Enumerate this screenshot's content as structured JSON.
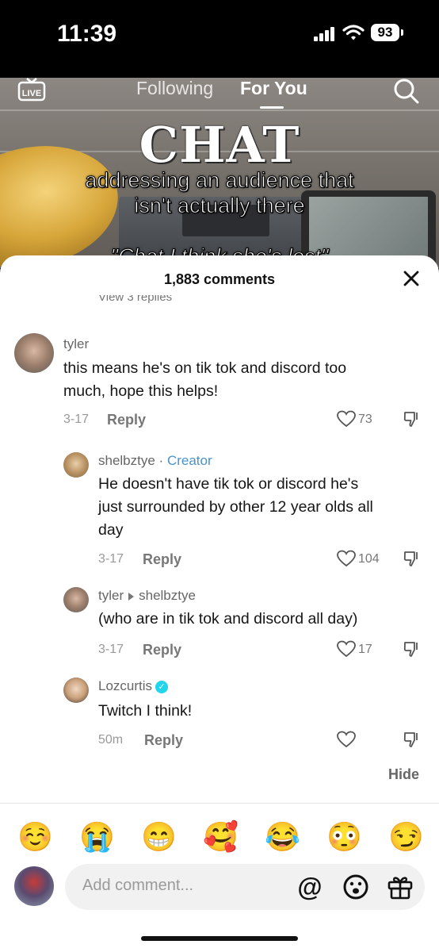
{
  "status_bar": {
    "time": "11:39",
    "battery": "93"
  },
  "video": {
    "tabs": {
      "following": "Following",
      "for_you": "For You"
    },
    "title": "CHAT",
    "caption_line1": "addressing an audience that",
    "caption_line2": "isn't actually there",
    "caption_line3": "\"Chat I think she's lost\""
  },
  "comments_panel": {
    "count_label": "1,883 comments",
    "view_replies": "View 3 replies",
    "comments": [
      {
        "username": "tyler",
        "text_line1": "this means he's on tik tok and discord too",
        "text_line2": "much, hope this helps!",
        "date": "3-17",
        "reply": "Reply",
        "likes": "73"
      },
      {
        "username": "shelbztye",
        "creator_label": "Creator",
        "text_line1": "He doesn't have tik tok or discord he's",
        "text_line2": "just surrounded by other 12 year olds all",
        "text_line3": "day",
        "date": "3-17",
        "reply": "Reply",
        "likes": "104"
      },
      {
        "username": "tyler",
        "reply_to": "shelbztye",
        "text_line1": "(who are in tik tok and discord all day)",
        "date": "3-17",
        "reply": "Reply",
        "likes": "17"
      },
      {
        "username": "Lozcurtis",
        "text_line1": "Twitch I think!",
        "date": "50m",
        "reply": "Reply",
        "likes": ""
      }
    ],
    "hide_label": "Hide"
  },
  "emoji_bar": [
    "☺️",
    "😭",
    "😁",
    "🥰",
    "😂",
    "😳",
    "😏"
  ],
  "composer": {
    "placeholder": "Add comment..."
  },
  "colors": {
    "accent_creator": "#4b93c7",
    "verified": "#20d5ec"
  }
}
